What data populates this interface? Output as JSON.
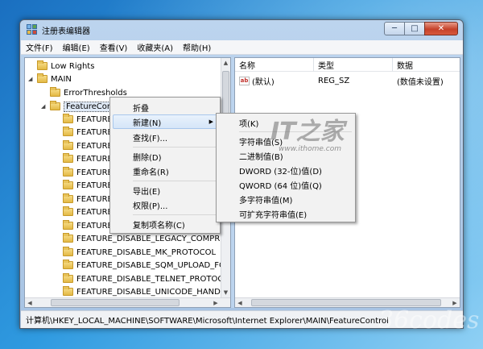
{
  "window": {
    "title": "注册表编辑器",
    "controls": {
      "minimize": "─",
      "maximize": "□",
      "close": "✕"
    }
  },
  "menubar": [
    "文件(F)",
    "编辑(E)",
    "查看(V)",
    "收藏夹(A)",
    "帮助(H)"
  ],
  "tree": {
    "items": [
      {
        "label": "Low Rights",
        "expander": "",
        "folder": true
      },
      {
        "label": "MAIN",
        "expander": "◢",
        "folder": true
      },
      {
        "label": "ErrorThresholds",
        "expander": "",
        "folder": true
      },
      {
        "label": "FeatureControl",
        "expander": "◢",
        "folder": true,
        "selected": true
      },
      {
        "label": "FEATURE_",
        "expander": "",
        "folder": true
      },
      {
        "label": "FEATURE_",
        "expander": "",
        "folder": true
      },
      {
        "label": "FEATURE_",
        "expander": "",
        "folder": true
      },
      {
        "label": "FEATURE_",
        "expander": "",
        "folder": true
      },
      {
        "label": "FEATURE_",
        "expander": "",
        "folder": true
      },
      {
        "label": "FEATURE_",
        "expander": "",
        "folder": true
      },
      {
        "label": "FEATURE_",
        "expander": "",
        "folder": true
      },
      {
        "label": "FEATURE_",
        "expander": "",
        "folder": true
      },
      {
        "label": "FEATURE_",
        "expander": "",
        "folder": true
      },
      {
        "label": "FEATURE_DISABLE_LEGACY_COMPRES",
        "expander": "",
        "folder": true
      },
      {
        "label": "FEATURE_DISABLE_MK_PROTOCOL",
        "expander": "",
        "folder": true
      },
      {
        "label": "FEATURE_DISABLE_SQM_UPLOAD_FOF",
        "expander": "",
        "folder": true
      },
      {
        "label": "FEATURE_DISABLE_TELNET_PROTOCC",
        "expander": "",
        "folder": true
      },
      {
        "label": "FEATURE_DISABLE_UNICODE_HANDLE",
        "expander": "",
        "folder": true
      }
    ]
  },
  "list": {
    "headers": [
      "名称",
      "类型",
      "数据"
    ],
    "rows": [
      {
        "name": "(默认)",
        "type": "REG_SZ",
        "data": "(数值未设置)",
        "icon_text": "ab"
      }
    ]
  },
  "context_menu": {
    "items": [
      "折叠",
      "新建(N)",
      "查找(F)...",
      "删除(D)",
      "重命名(R)",
      "导出(E)",
      "权限(P)...",
      "复制项名称(C)"
    ],
    "submenu_arrow": "▶"
  },
  "submenu": {
    "items": [
      "项(K)",
      "字符串值(S)",
      "二进制值(B)",
      "DWORD (32-位)值(D)",
      "QWORD (64 位)值(Q)",
      "多字符串值(M)",
      "可扩充字符串值(E)"
    ]
  },
  "statusbar": {
    "path": "计算机\\HKEY_LOCAL_MACHINE\\SOFTWARE\\Microsoft\\Internet Explorer\\MAIN\\FeatureControl"
  },
  "watermark": {
    "logo": "IT之家",
    "url": "www.ithome.com",
    "corner": "36codes"
  },
  "colors": {
    "desktop": "#2f9ae0",
    "titlebar": "#bcd4ee",
    "selection": "#dfe9f6",
    "close_button": "#c6422a"
  }
}
